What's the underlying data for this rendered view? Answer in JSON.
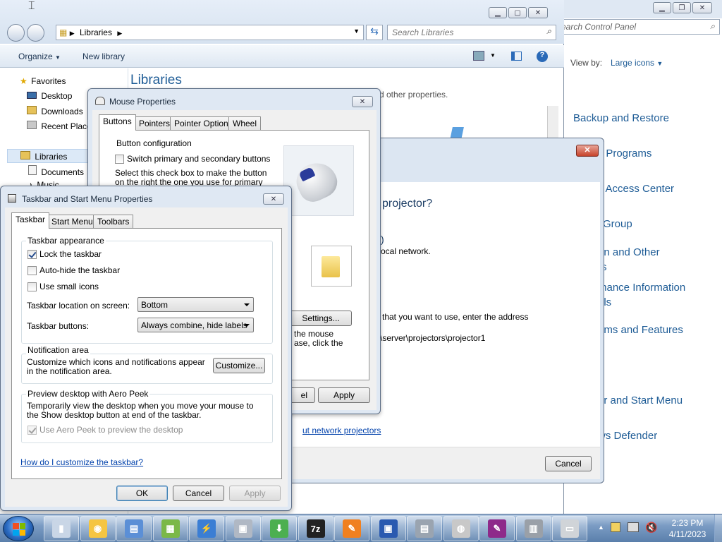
{
  "explorer": {
    "breadcrumb": "Libraries",
    "search_placeholder": "Search Libraries",
    "toolbar": {
      "organize": "Organize",
      "new_library": "New library"
    },
    "nav": {
      "favorites": "Favorites",
      "desktop": "Desktop",
      "downloads": "Downloads",
      "recent": "Recent Places",
      "libraries": "Libraries",
      "documents": "Documents",
      "music": "Music"
    },
    "heading": "Libraries",
    "subtext": "d other properties."
  },
  "control_panel": {
    "search_placeholder": "earch Control Panel",
    "view_by_label": "View by:",
    "view_by_value": "Large icons",
    "items": [
      "Backup and Restore",
      "t Programs",
      "f Access Center",
      "Group",
      "on and Other",
      "rs",
      "mance Information",
      "ols",
      "ams and Features",
      "ar and Start Menu",
      "ws Defender"
    ]
  },
  "projector": {
    "heading": "projector?",
    "line1": ")",
    "line2": "ocal network.",
    "line3": "that you want to use, enter the address",
    "line4": "\\server\\projectors\\projector1",
    "link": "ut network projectors",
    "cancel": "Cancel"
  },
  "mouse": {
    "title": "Mouse Properties",
    "tabs": [
      "Buttons",
      "Pointers",
      "Pointer Options",
      "Wheel"
    ],
    "group": "Button configuration",
    "switch_label": "Switch primary and secondary buttons",
    "desc": "Select this check box to make the button on the right the one you use for primary functions such",
    "settings": "Settings...",
    "lock_text1": "the mouse",
    "lock_text2": "ase, click the",
    "cancel_part": "el",
    "apply": "Apply"
  },
  "taskbar_props": {
    "title": "Taskbar and Start Menu Properties",
    "tabs": [
      "Taskbar",
      "Start Menu",
      "Toolbars"
    ],
    "appearance": "Taskbar appearance",
    "lock": "Lock the taskbar",
    "autohide": "Auto-hide the taskbar",
    "small_icons": "Use small icons",
    "location_label": "Taskbar location on screen:",
    "location_value": "Bottom",
    "buttons_label": "Taskbar buttons:",
    "buttons_value": "Always combine, hide labels",
    "notif_heading": "Notification area",
    "notif_text": "Customize which icons and notifications appear in the notification area.",
    "customize": "Customize...",
    "peek_heading": "Preview desktop with Aero Peek",
    "peek_text": "Temporarily view the desktop when you move your mouse to the Show desktop button at end of the taskbar.",
    "peek_cb": "Use Aero Peek to preview the desktop",
    "help_link": "How do I customize the taskbar?",
    "ok": "OK",
    "cancel": "Cancel",
    "apply": "Apply"
  },
  "tray": {
    "time": "2:23 PM",
    "date": "4/11/2023"
  },
  "taskbar_items": [
    "file-manager-icon",
    "chrome-icon",
    "text-editor-icon",
    "winrar-icon",
    "flash-icon",
    "projector-icon",
    "download-icon",
    "7zip-icon",
    "pdf-reader-icon",
    "save-icon",
    "printer-icon",
    "speaker-icon",
    "pdf-creator-icon",
    "server-icon",
    "keyboard-icon"
  ]
}
